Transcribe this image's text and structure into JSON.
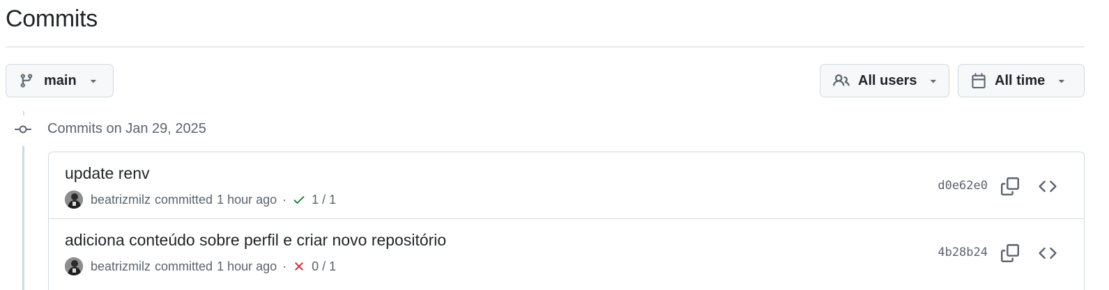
{
  "page": {
    "title": "Commits"
  },
  "filters": {
    "branch": {
      "label": "main",
      "icon": "git-branch-icon"
    },
    "users": {
      "label": "All users",
      "icon": "people-icon"
    },
    "time": {
      "label": "All time",
      "icon": "calendar-icon"
    }
  },
  "commit_group": {
    "heading": "Commits on Jan 29, 2025",
    "icon": "git-commit-icon"
  },
  "commits": [
    {
      "title": "update renv",
      "author": "beatrizmilz",
      "action": "committed",
      "time": "1 hour ago",
      "separator": "·",
      "status": "success",
      "status_icon": "check-icon",
      "status_color": "#1a7f37",
      "checks": "1 / 1",
      "sha": "d0e62e0"
    },
    {
      "title": "adiciona conteúdo sobre perfil e criar novo repositório",
      "author": "beatrizmilz",
      "action": "committed",
      "time": "1 hour ago",
      "separator": "·",
      "status": "failure",
      "status_icon": "x-icon",
      "status_color": "#d1242f",
      "checks": "0 / 1",
      "sha": "4b28b24"
    }
  ],
  "colors": {
    "text_primary": "#1f2328",
    "text_muted": "#59636e",
    "border": "#d1d9e0",
    "button_bg": "#f6f8fa"
  }
}
